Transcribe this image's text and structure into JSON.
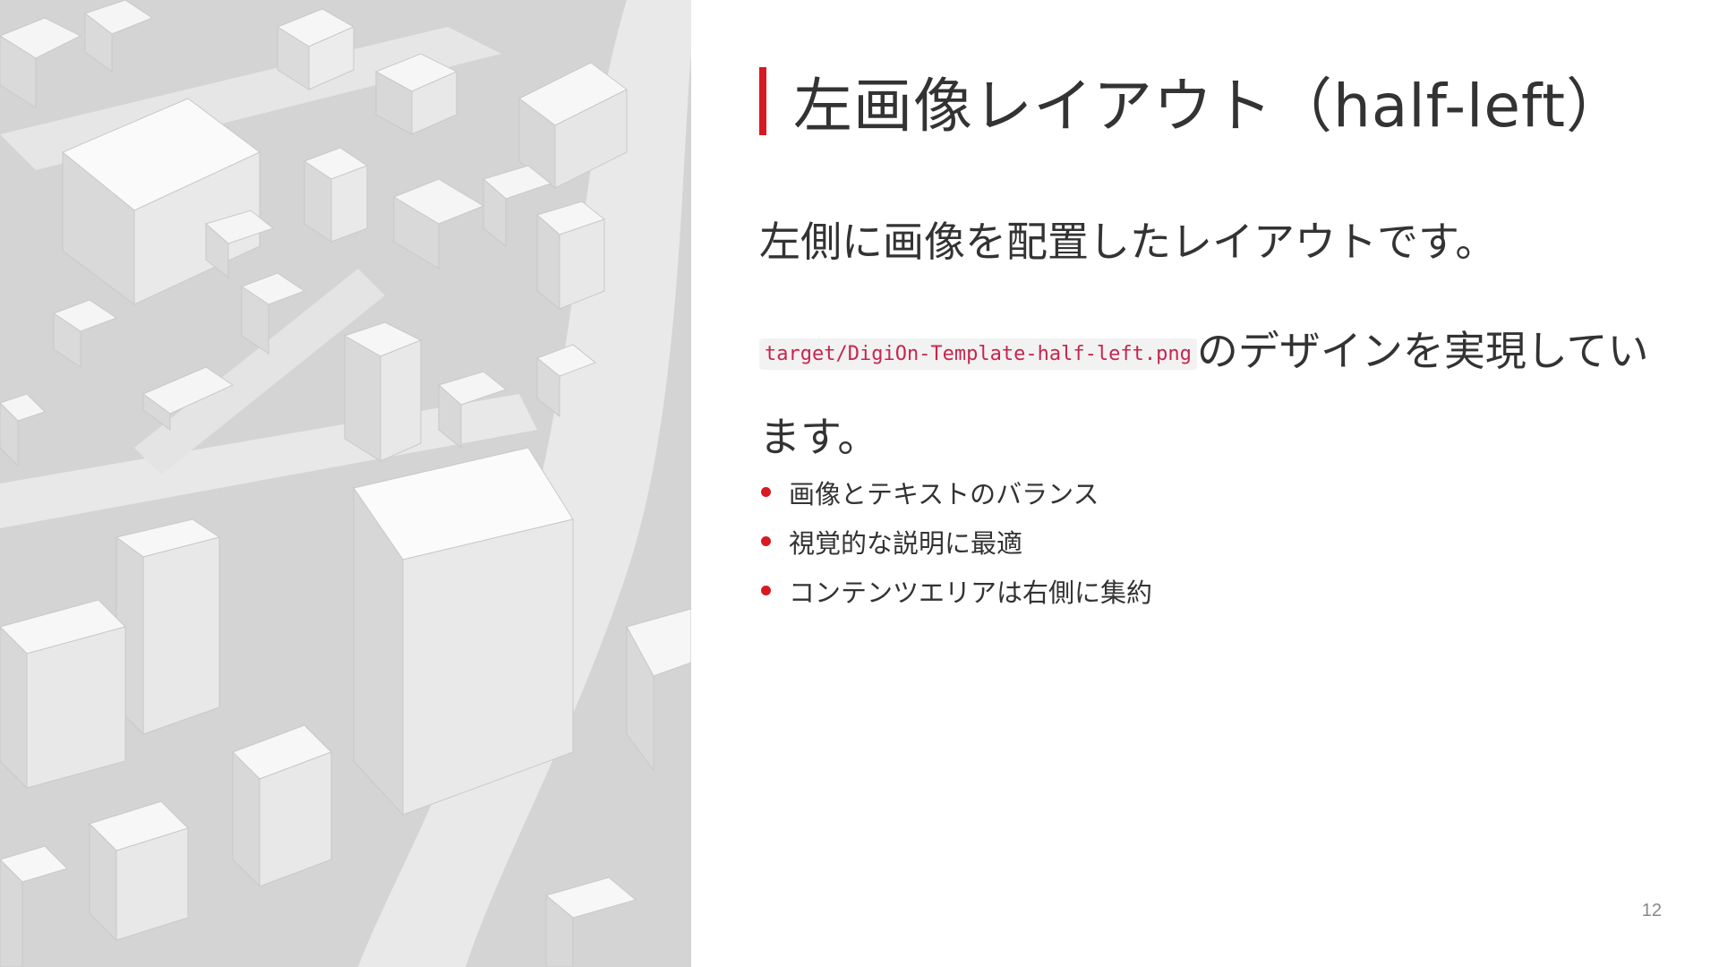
{
  "slide": {
    "title": "左画像レイアウト（half-left）",
    "lead": "左側に画像を配置したレイアウトです。",
    "description": {
      "code": "target/DigiOn-Template-half-left.png",
      "text": "のデザインを実現しています。"
    },
    "bullets": [
      "画像とテキストのバランス",
      "視覚的な説明に最適",
      "コンテンツエリアは右側に集約"
    ],
    "page_number": "12"
  },
  "colors": {
    "accent": "#d71921",
    "text": "#333333",
    "code_text": "#c7254e",
    "code_bg": "#f2f2f2",
    "page_number": "#888888"
  },
  "image": {
    "description_icon": "city-3d-model-image"
  }
}
